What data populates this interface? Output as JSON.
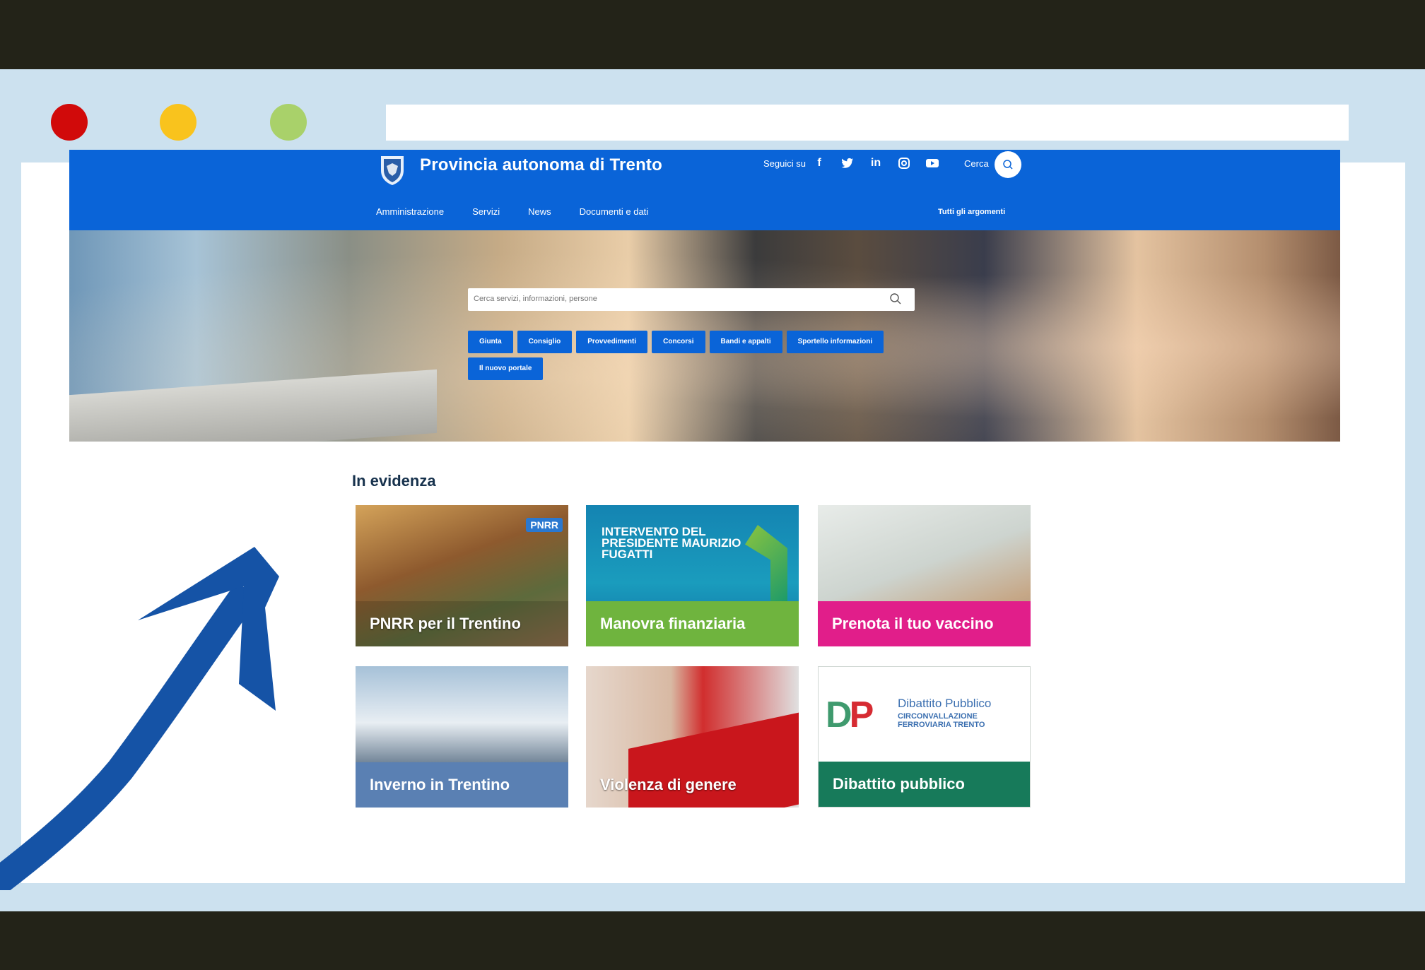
{
  "header": {
    "title": "Provincia autonoma di Trento",
    "follow_label": "Seguici su",
    "socials": [
      "facebook-icon",
      "twitter-icon",
      "linkedin-icon",
      "instagram-icon",
      "youtube-icon"
    ],
    "social_glyphs": [
      "f",
      "🐦",
      "in",
      "◎",
      "▶"
    ],
    "search_label": "Cerca",
    "nav": [
      "Amministrazione",
      "Servizi",
      "News",
      "Documenti e dati"
    ],
    "all_topics": "Tutti gli argomenti"
  },
  "hero": {
    "search_placeholder": "Cerca servizi, informazioni, persone",
    "quick_links": [
      "Giunta",
      "Consiglio",
      "Provvedimenti",
      "Concorsi",
      "Bandi e appalti",
      "Sportello informazioni",
      "Il nuovo portale"
    ]
  },
  "highlights": {
    "title": "In evidenza",
    "tiles": [
      {
        "label": "PNRR per il Trentino",
        "badge": "PNRR"
      },
      {
        "label": "Manovra finanziaria",
        "headline": "INTERVENTO DEL PRESIDENTE MAURIZIO FUGATTI"
      },
      {
        "label": "Prenota il tuo vaccino"
      },
      {
        "label": "Inverno in Trentino"
      },
      {
        "label": "Violenza di genere"
      },
      {
        "label": "Dibattito pubblico",
        "logo": "DP",
        "logo_title": "Dibattito Pubblico",
        "logo_sub": "CIRCONVALLAZIONE FERROVIARIA TRENTO"
      }
    ]
  },
  "colors": {
    "brand_blue": "#0a64d8",
    "frame_dark": "#232318",
    "frame_light": "#cce1ef",
    "arrow": "#1553a6"
  }
}
